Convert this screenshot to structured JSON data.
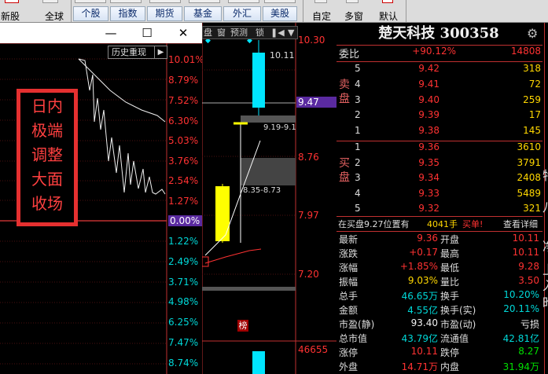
{
  "toolbar": {
    "left_items": [
      {
        "name": "新股",
        "label": "新股"
      },
      {
        "name": "全球",
        "label": "全球"
      }
    ],
    "tabs_row": [
      {
        "label": "个股"
      },
      {
        "label": "指数"
      },
      {
        "label": "期货"
      },
      {
        "label": "基金"
      },
      {
        "label": "外汇"
      },
      {
        "label": "美股"
      }
    ],
    "right_items": [
      {
        "label": "自定"
      },
      {
        "label": "多窗"
      },
      {
        "label": "默认"
      }
    ]
  },
  "window": {
    "restore_symbol": "☐",
    "close_symbol": "✕",
    "minimize_symbol": "—"
  },
  "left_chart": {
    "history_button": "历史重现",
    "pct_labels": [
      {
        "text": "10.01%",
        "kind": "up"
      },
      {
        "text": "8.79%",
        "kind": "up"
      },
      {
        "text": "7.52%",
        "kind": "up"
      },
      {
        "text": "6.30%",
        "kind": "up"
      },
      {
        "text": "5.03%",
        "kind": "up"
      },
      {
        "text": "3.76%",
        "kind": "up"
      },
      {
        "text": "2.54%",
        "kind": "up"
      },
      {
        "text": "1.27%",
        "kind": "up"
      },
      {
        "text": "0.00%",
        "kind": "zero"
      },
      {
        "text": "1.22%",
        "kind": "dn"
      },
      {
        "text": "2.49%",
        "kind": "dn"
      },
      {
        "text": "3.71%",
        "kind": "dn"
      },
      {
        "text": "4.98%",
        "kind": "dn"
      },
      {
        "text": "6.25%",
        "kind": "dn"
      },
      {
        "text": "7.47%",
        "kind": "dn"
      },
      {
        "text": "8.74%",
        "kind": "dn"
      }
    ],
    "annotation": [
      "日内",
      "极端",
      "调整",
      "大面",
      "收场"
    ]
  },
  "mid_panel": {
    "toolbar": [
      "盘",
      "窗",
      "预测",
      "锁",
      "❚◀",
      "▼"
    ],
    "price_labels": [
      {
        "text": "10.30"
      },
      {
        "text": "9.47",
        "selected": true
      },
      {
        "text": "8.76"
      },
      {
        "text": "7.97"
      },
      {
        "text": "7.20"
      }
    ],
    "kline_label_high": "10.11",
    "kline_label_range1": "9.19-9.1",
    "kline_label_range2": "8.35-8.73",
    "volume_label": "46655",
    "badge": "榜"
  },
  "quote": {
    "stock_name": "楚天科技",
    "stock_code": "300358",
    "title": "楚天科技 300358",
    "weibi_label": "委比",
    "weibi_value": "+90.12%",
    "weibi_vol": "14808",
    "sell_side_label": "卖盘",
    "buy_side_label": "买盘",
    "sell_rows": [
      {
        "level": "5",
        "price": "9.42",
        "vol": "318"
      },
      {
        "level": "4",
        "price": "9.41",
        "vol": "72"
      },
      {
        "level": "3",
        "price": "9.40",
        "vol": "259"
      },
      {
        "level": "2",
        "price": "9.39",
        "vol": "17"
      },
      {
        "level": "1",
        "price": "9.38",
        "vol": "145"
      }
    ],
    "buy_rows": [
      {
        "level": "1",
        "price": "9.36",
        "vol": "3610"
      },
      {
        "level": "2",
        "price": "9.35",
        "vol": "3791"
      },
      {
        "level": "3",
        "price": "9.34",
        "vol": "2408"
      },
      {
        "level": "4",
        "price": "9.33",
        "vol": "5489"
      },
      {
        "level": "5",
        "price": "9.32",
        "vol": "321"
      }
    ],
    "notice": "在买盘9.27位置有",
    "notice_vol": "4041手",
    "notice_action": "买单!",
    "notice_link": "查看详细",
    "stats": [
      [
        {
          "k": "最新",
          "v": "9.36",
          "c": "red"
        },
        {
          "k": "开盘",
          "v": "10.11",
          "c": "red"
        }
      ],
      [
        {
          "k": "涨跌",
          "v": "+0.17",
          "c": "red"
        },
        {
          "k": "最高",
          "v": "10.11",
          "c": "red"
        }
      ],
      [
        {
          "k": "涨幅",
          "v": "+1.85%",
          "c": "red"
        },
        {
          "k": "最低",
          "v": "9.28",
          "c": "red"
        }
      ],
      [
        {
          "k": "振幅",
          "v": "9.03%",
          "c": "yel"
        },
        {
          "k": "量比",
          "v": "3.50",
          "c": "red"
        }
      ],
      [
        {
          "k": "总手",
          "v": "46.65万",
          "c": "cyan"
        },
        {
          "k": "换手",
          "v": "10.20%",
          "c": "cyan"
        }
      ],
      [
        {
          "k": "金额",
          "v": "4.55亿",
          "c": "cyan"
        },
        {
          "k": "换手(实)",
          "v": "20.11%",
          "c": "cyan"
        }
      ],
      [
        {
          "k": "市盈(静)",
          "v": "93.40",
          "c": "wht"
        },
        {
          "k": "市盈(动)",
          "v": "亏损",
          "c": "wht"
        }
      ],
      [
        {
          "k": "总市值",
          "v": "43.79亿",
          "c": "cyan"
        },
        {
          "k": "流通值",
          "v": "42.81亿",
          "c": "cyan"
        }
      ],
      [
        {
          "k": "涨停",
          "v": "10.11",
          "c": "red"
        },
        {
          "k": "跌停",
          "v": "8.27",
          "c": "green"
        }
      ],
      [
        {
          "k": "外盘",
          "v": "14.71万",
          "c": "red"
        },
        {
          "k": "内盘",
          "v": "31.94万",
          "c": "green"
        }
      ]
    ],
    "side_chars": [
      "特",
      "八",
      "净",
      "上",
      "入",
      "昨"
    ]
  }
}
